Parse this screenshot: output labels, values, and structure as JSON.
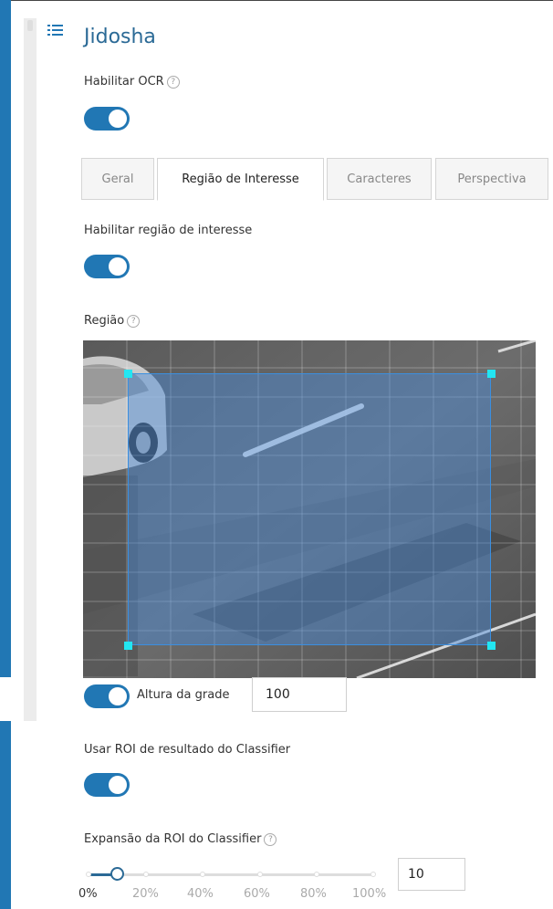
{
  "panel": {
    "title": "Jidosha",
    "icon": "list-icon"
  },
  "ocr": {
    "label": "Habilitar OCR",
    "help_icon": "?",
    "enabled": true
  },
  "tabs": [
    {
      "label": "Geral",
      "active": false
    },
    {
      "label": "Região de Interesse",
      "active": true
    },
    {
      "label": "Caracteres",
      "active": false
    },
    {
      "label": "Perspectiva",
      "active": false
    }
  ],
  "roi": {
    "enable_label": "Habilitar região de interesse",
    "enabled": true,
    "region_label": "Região",
    "help_icon": "?",
    "grid_toggle_on": true,
    "grid_height_label": "Altura da grade",
    "grid_height_value": "100"
  },
  "classifier": {
    "use_roi_label": "Usar ROI de resultado do Classifier",
    "use_roi_enabled": true,
    "expansion_label": "Expansão da ROI do Classifier",
    "help_icon": "?",
    "expansion_value": "10",
    "expansion_percent": 10,
    "ticks": [
      "0%",
      "20%",
      "40%",
      "60%",
      "80%",
      "100%"
    ]
  },
  "colors": {
    "accent": "#2177b4",
    "roi_handle": "#22e6f2",
    "roi_fill": "#4a8cdc"
  }
}
